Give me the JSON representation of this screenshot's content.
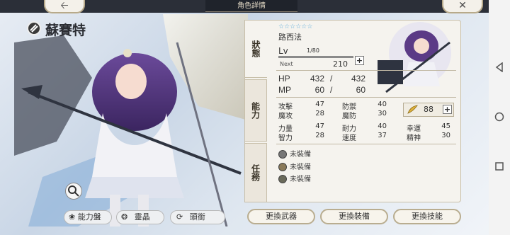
{
  "header": {
    "title": "角色詳情",
    "back_icon": "back-arrow-icon",
    "close_icon": "close-icon"
  },
  "character": {
    "name": "蘇賽特",
    "element_icon": "element-orb-icon",
    "title": "路西法",
    "stars": "☆☆☆☆☆☆",
    "level_label": "Lv",
    "level": "1",
    "level_max": "/80",
    "level_progress": 0.0,
    "next_label": "Next",
    "next_value": "210"
  },
  "tabs": [
    {
      "label": "狀態"
    },
    {
      "label": "能力"
    },
    {
      "label": "任務"
    }
  ],
  "stats": {
    "hp_label": "HP",
    "hp": "432",
    "hp_sep": "/",
    "hp_max": "432",
    "mp_label": "MP",
    "mp": "60",
    "mp_sep": "/",
    "mp_max": "60"
  },
  "abilities": {
    "atk_label": "攻擊",
    "atk": "47",
    "def_label": "防禦",
    "def": "40",
    "matk_label": "魔攻",
    "matk": "28",
    "mdef_label": "魔防",
    "mdef": "30",
    "str_label": "力量",
    "str": "47",
    "end_label": "耐力",
    "end": "40",
    "luck_label": "幸運",
    "luck": "45",
    "int_label": "智力",
    "int": "28",
    "spd_label": "速度",
    "spd": "37",
    "spirit_label": "精神",
    "spirit": "30"
  },
  "wings": {
    "value": "88",
    "icon": "wing-icon"
  },
  "equipment": [
    {
      "label": "未裝備",
      "icon": "weapon-slot-icon"
    },
    {
      "label": "未裝備",
      "icon": "armor-slot-icon"
    },
    {
      "label": "未裝備",
      "icon": "accessory-slot-icon"
    }
  ],
  "left_buttons": {
    "ability_board": "能力盤",
    "spirit_crystal": "靈晶",
    "title": "頭銜"
  },
  "actions": {
    "change_weapon": "更換武器",
    "change_equipment": "更換裝備",
    "change_skill": "更換技能"
  },
  "colors": {
    "accent_blue": "#55bbee",
    "panel_bg": "#f5f3ee",
    "border_gold": "#b9ad90",
    "topbar": "#2b2f38"
  }
}
